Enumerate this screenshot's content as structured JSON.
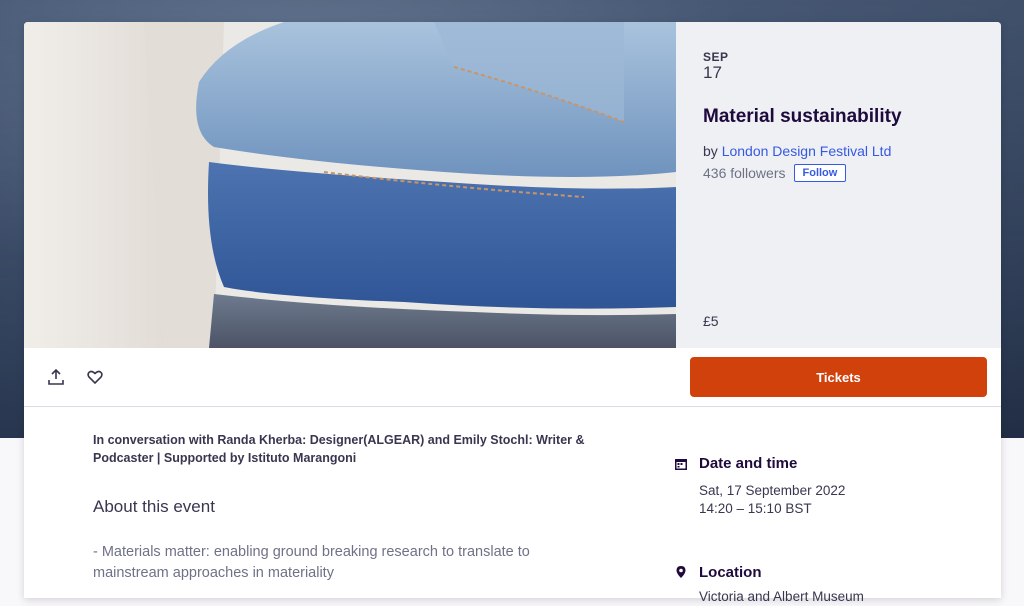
{
  "event": {
    "month": "SEP",
    "day": "17",
    "title": "Material sustainability",
    "by_prefix": "by ",
    "organizer": "London Design Festival Ltd",
    "followers": "436 followers",
    "follow_label": "Follow",
    "price": "£5"
  },
  "actions": {
    "share_icon": "share-icon",
    "like_icon": "heart-icon",
    "tickets_label": "Tickets"
  },
  "details": {
    "summary": "In conversation with Randa Kherba: Designer(ALGEAR) and Emily Stochl: Writer & Podcaster | Supported by Istituto Marangoni",
    "about_heading": "About this event",
    "about_text": "- Materials matter: enabling ground breaking research to translate to mainstream approaches in materiality"
  },
  "sidebar": {
    "date_heading": "Date and time",
    "date_line": "Sat, 17 September 2022",
    "time_line": "14:20 – 15:10 BST",
    "location_heading": "Location",
    "location_line": "Victoria and Albert Museum"
  },
  "colors": {
    "accent": "#d1410c",
    "link": "#3659e3",
    "text": "#1e0a3c"
  }
}
